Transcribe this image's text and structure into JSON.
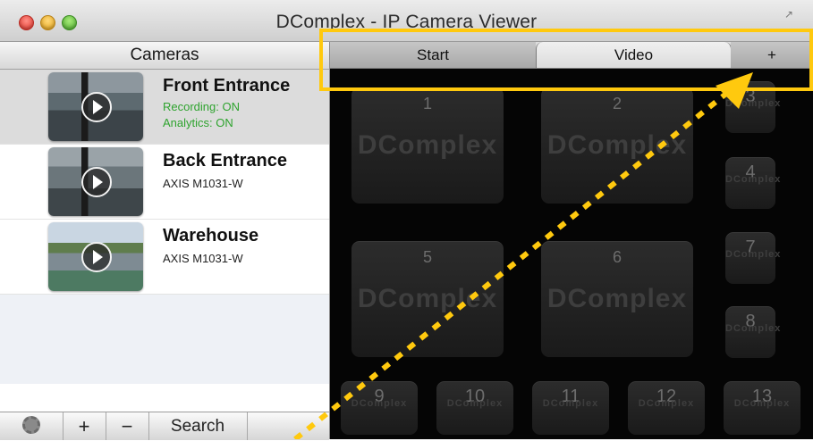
{
  "window": {
    "title": "DComplex - IP Camera Viewer"
  },
  "sidebar": {
    "header": "Cameras",
    "cameras": [
      {
        "name": "Front Entrance",
        "line1": "Recording: ON",
        "line2": "Analytics: ON",
        "selected": true
      },
      {
        "name": "Back Entrance",
        "line1": "AXIS M1031-W"
      },
      {
        "name": "Warehouse",
        "line1": "AXIS M1031-W"
      }
    ],
    "toolbar": {
      "plus": "+",
      "minus": "−",
      "search": "Search"
    }
  },
  "tabs": {
    "start": "Start",
    "video": "Video",
    "plus": "+"
  },
  "grid": {
    "brand": "DComplex",
    "tiles": [
      "1",
      "2",
      "3",
      "4",
      "5",
      "6",
      "7",
      "8",
      "9",
      "10",
      "11",
      "12",
      "13"
    ]
  },
  "colors": {
    "annotation": "#ffc90e",
    "recording_status": "#2ea32e"
  }
}
